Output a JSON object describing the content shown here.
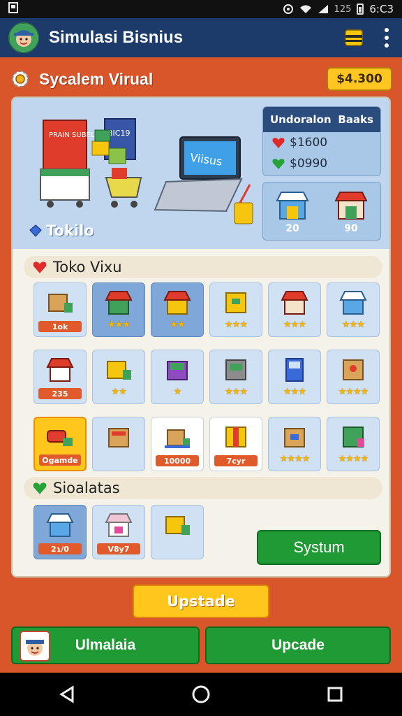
{
  "status": {
    "time": "6:C3",
    "battery": "125"
  },
  "appbar": {
    "title": "Simulasi Bisnius"
  },
  "header": {
    "heading": "Sycalem Virual",
    "money": "$4.300"
  },
  "scene": {
    "shop_sign_1": "PRAIN SUBELM",
    "shop_sign_2": "BIC19",
    "laptop_text": "Viisus",
    "tokilo_label": "Tokilo"
  },
  "stats": {
    "col1": "Undoralon",
    "col2": "Baaks",
    "red_value": "$1600",
    "green_value": "$0990"
  },
  "stores": {
    "store1_value": "20",
    "store2_value": "90"
  },
  "section1": {
    "title": "Toko Vixu"
  },
  "section2": {
    "title": "Sioalatas"
  },
  "tiles": {
    "t1_price": "1ok",
    "t7_price": "235",
    "t13_price": "Ogamde",
    "t15_price": "10000",
    "t16_price": "7cyr",
    "s1_price": "2ɿ/0",
    "s2_price": "V8y7"
  },
  "buttons": {
    "system": "Systum",
    "upgrade_main": "Upstade",
    "bottom_left": "Ulmalaia",
    "bottom_right": "Upcade"
  },
  "colors": {
    "appbar": "#1c3b6b",
    "background": "#d9552a",
    "green": "#1f9a34",
    "gold": "#ffc61c"
  }
}
